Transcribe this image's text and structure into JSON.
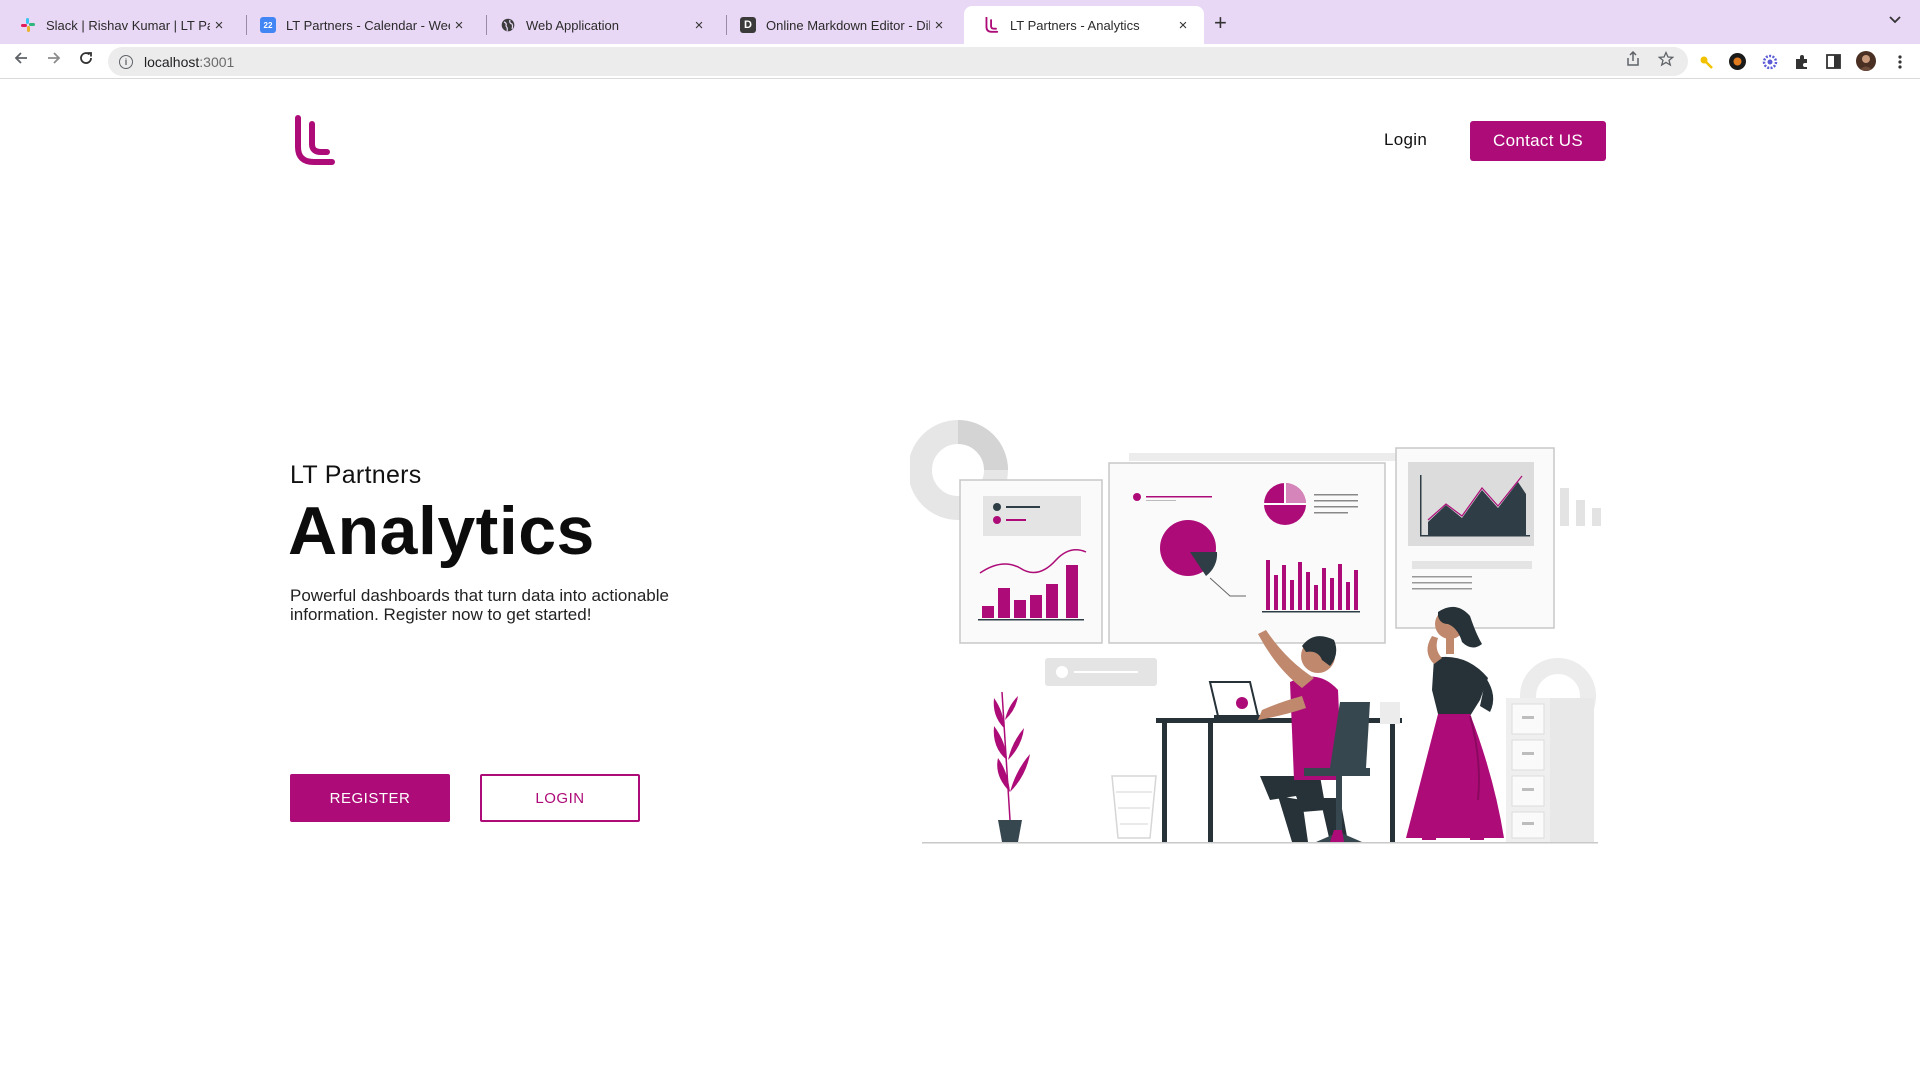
{
  "browser": {
    "tabs": [
      {
        "title": "Slack | Rishav Kumar | LT Partners",
        "icon": "slack-icon",
        "active": false
      },
      {
        "title": "LT Partners - Calendar - Week",
        "icon": "calendar-icon",
        "active": false
      },
      {
        "title": "Web Application",
        "icon": "globe-icon",
        "active": false
      },
      {
        "title": "Online Markdown Editor - Dillinger",
        "icon": "dillinger-icon",
        "active": false
      },
      {
        "title": "LT Partners - Analytics",
        "icon": "lt-logo-icon",
        "active": true
      }
    ],
    "url_host": "localhost",
    "url_port": ":3001",
    "tab_strip_color": "#e8d7f5"
  },
  "header": {
    "login_label": "Login",
    "contact_label": "Contact US"
  },
  "hero": {
    "subtitle": "LT Partners",
    "title": "Analytics",
    "description": "Powerful dashboards that turn data into actionable information. Register now to get started!",
    "register_label": "REGISTER",
    "login_label": "LOGIN"
  },
  "colors": {
    "brand": "#ad0c78",
    "dark": "#2f3e46",
    "light_gray": "#e6e6e6"
  }
}
